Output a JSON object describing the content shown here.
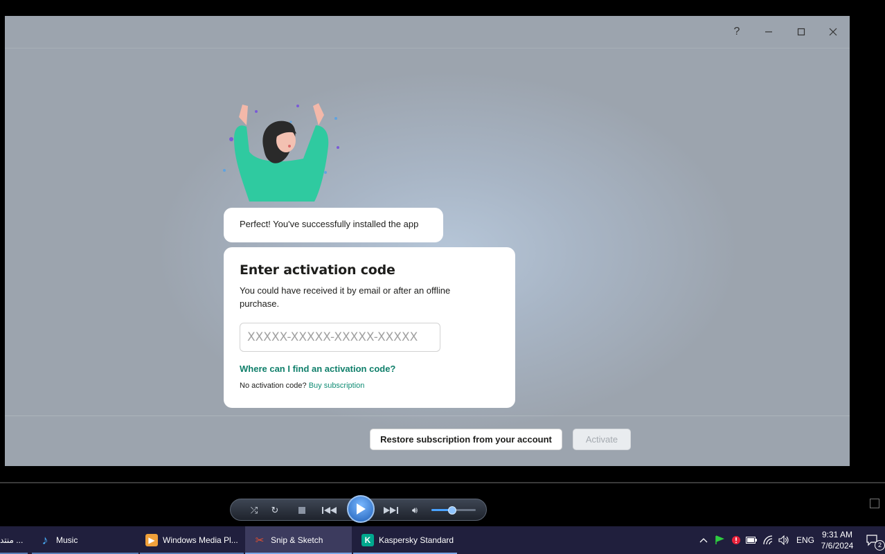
{
  "window": {
    "controls": {
      "help": "?",
      "minimize": "–",
      "maximize": "☐",
      "close": "✕"
    }
  },
  "message_bubble": "Perfect! You've successfully installed the app",
  "card": {
    "title": "Enter activation code",
    "description": "You could have received it by email or after an offline purchase.",
    "code_placeholder": "XXXXX-XXXXX-XXXXX-XXXXX",
    "code_value": "",
    "find_link": "Where can I find an activation code?",
    "no_code_text": "No activation code?",
    "buy_link": "Buy subscription"
  },
  "buttons": {
    "restore": "Restore subscription from your account",
    "activate": "Activate"
  },
  "player": {
    "volume_level": 0.45
  },
  "taskbar": {
    "items": [
      {
        "label": "منتد ...",
        "icon": "browser-icon"
      },
      {
        "label": "Music",
        "icon": "music-note-icon"
      },
      {
        "label": "Windows Media Pl...",
        "icon": "media-player-icon"
      },
      {
        "label": "Snip & Sketch",
        "icon": "snip-sketch-icon"
      },
      {
        "label": "Kaspersky Standard",
        "icon": "kaspersky-icon"
      }
    ],
    "language": "ENG",
    "time": "9:31 AM",
    "date": "7/6/2024",
    "notification_count": "2"
  },
  "colors": {
    "accent_green": "#0f7f6a",
    "taskbar_bg": "#201f3d",
    "kaspersky_green": "#00a88e"
  }
}
